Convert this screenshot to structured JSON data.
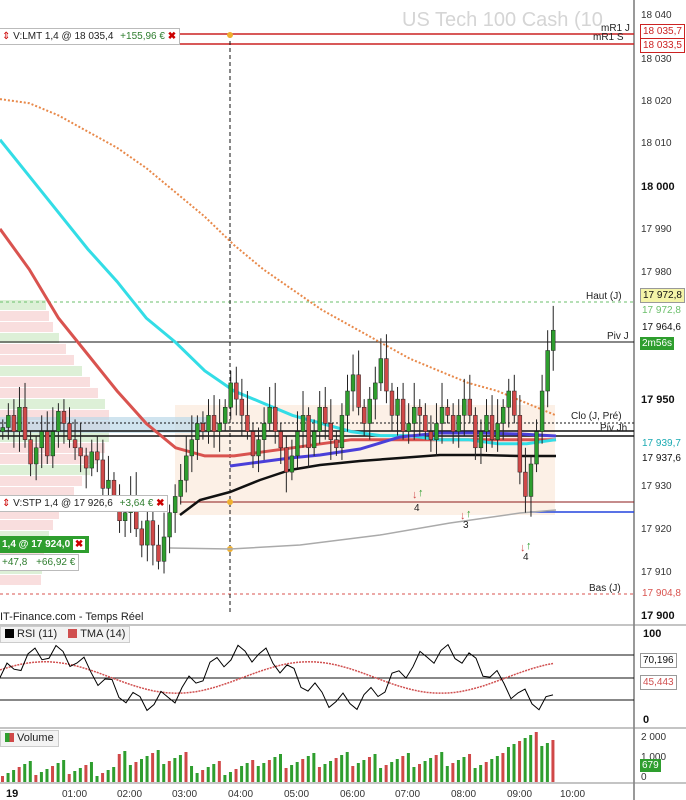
{
  "watermark": "US Tech 100 Cash (10",
  "source_label": "IT-Finance.com - Temps Réel",
  "colors": {
    "up": "#2e9e2e",
    "down": "#d04848",
    "resistance": "#cc2222",
    "support": "#2244dd",
    "sma_orange": "#e8894a",
    "sma_red": "#d9534f",
    "sma_cyan": "#33dde6",
    "vwap_blue": "#4a3fd9",
    "vwap_black": "#111111",
    "gray_curve": "#aaaaaa",
    "rsi": "#000000",
    "tma": "#d05050",
    "vol_up": "#2e9e2e",
    "vol_down": "#d04848"
  },
  "price_axis": {
    "ticks": [
      "18 040",
      "18 030",
      "18 020",
      "18 010",
      "18 000",
      "17 990",
      "17 980",
      "17 950",
      "17 930",
      "17 920",
      "17 910",
      "17 900"
    ],
    "bold_ticks": [
      "18 000",
      "17 950",
      "17 900"
    ]
  },
  "time_axis": {
    "ticks": [
      "19",
      "01:00",
      "02:00",
      "03:00",
      "04:00",
      "05:00",
      "06:00",
      "07:00",
      "08:00",
      "09:00",
      "10:00"
    ]
  },
  "levels": [
    {
      "name": "mR1 J",
      "price_label": "18 035,7"
    },
    {
      "name": "mR1 S",
      "price_label": "18 033,5"
    },
    {
      "name": "Haut (J)",
      "price_label": "17 972,8"
    },
    {
      "name": "Piv J",
      "price_label": "17 964,6"
    },
    {
      "name": "Clo (J, Pré)",
      "price_label": ""
    },
    {
      "name": "Piv Jh",
      "price_label": ""
    },
    {
      "name": "Bas (J)",
      "price_label": "17 904,8"
    }
  ],
  "price_tags": {
    "last": "17 972,8",
    "timer": "2m56s",
    "cyan_level": "17 939,7",
    "level_937": "17 937,6"
  },
  "orders": {
    "lmt": {
      "text": "V:LMT  1,4  @  18 035,4",
      "pnl": "+155,96 €"
    },
    "stp": {
      "text": "V:STP  1,4  @  17 926,6",
      "pnl": "+3,64 €"
    },
    "pos": {
      "text": "1,4  @  17 924,0",
      "pts": "+47,8",
      "pnl": "+66,92 €"
    }
  },
  "signal_counts": [
    "4",
    "3",
    "4"
  ],
  "rsi_panel": {
    "legend": [
      {
        "name": "RSI (11)"
      },
      {
        "name": "TMA (14)"
      }
    ],
    "axis": [
      "100",
      "0"
    ],
    "values_shown": [
      "70,196",
      "45,443"
    ]
  },
  "volume_panel": {
    "legend": "Volume",
    "axis": [
      "2 000",
      "1 000",
      "0"
    ],
    "value_shown": "679"
  },
  "chart_data": {
    "type": "candlestick",
    "ylim": [
      17895,
      18043
    ],
    "x": [
      "19",
      "01:00",
      "02:00",
      "03:00",
      "04:00",
      "05:00",
      "06:00",
      "07:00",
      "08:00",
      "09:00",
      "10:00"
    ],
    "reference_levels": {
      "mR1 J": 18035.7,
      "mR1 S": 18033.5,
      "Haut (J)": 17972.8,
      "Piv J": 17964.6,
      "Clo (J, Pré)": 17943.0,
      "Piv Jh": 17941.5,
      "Bas (J)": 17904.8,
      "support": 17924.0,
      "stop": 17926.6
    },
    "candles_close": [
      17941,
      17944,
      17940,
      17946,
      17938,
      17932,
      17936,
      17940,
      17934,
      17940,
      17945,
      17942,
      17938,
      17936,
      17934,
      17931,
      17935,
      17933,
      17926,
      17928,
      17924,
      17918,
      17920,
      17924,
      17916,
      17912,
      17918,
      17912,
      17908,
      17914,
      17920,
      17924,
      17928,
      17934,
      17938,
      17942,
      17940,
      17944,
      17940,
      17942,
      17946,
      17952,
      17948,
      17944,
      17940,
      17934,
      17938,
      17942,
      17946,
      17940,
      17936,
      17930,
      17934,
      17940,
      17944,
      17936,
      17940,
      17946,
      17942,
      17938,
      17936,
      17944,
      17950,
      17954,
      17946,
      17942,
      17948,
      17952,
      17958,
      17950,
      17944,
      17948,
      17940,
      17942,
      17946,
      17944,
      17940,
      17938,
      17942,
      17946,
      17944,
      17940,
      17944,
      17948,
      17944,
      17936,
      17940,
      17944,
      17938,
      17942,
      17946,
      17950,
      17944,
      17930,
      17924,
      17932,
      17940,
      17950,
      17960,
      17965
    ],
    "series": [
      {
        "name": "SMA orange",
        "values": [
          18022,
          18021,
          18018,
          18014,
          18010,
          18005,
          17999,
          17993,
          17986,
          17980,
          17975,
          17970,
          17966,
          17962,
          17958,
          17955,
          17952,
          17950,
          17947,
          17944
        ]
      },
      {
        "name": "SMA cyan",
        "values": [
          18012,
          18003,
          17994,
          17985,
          17977,
          17968,
          17962,
          17955,
          17950,
          17947,
          17944,
          17942,
          17940,
          17939,
          17939,
          17938,
          17938,
          17937,
          17937,
          17938
        ]
      },
      {
        "name": "SMA red",
        "values": [
          17990,
          17980,
          17968,
          17959,
          17950,
          17942,
          17936,
          17934,
          17934,
          17935,
          17936,
          17937,
          17938,
          17938,
          17938,
          17938,
          17938,
          17938,
          17938,
          17938
        ]
      }
    ]
  }
}
